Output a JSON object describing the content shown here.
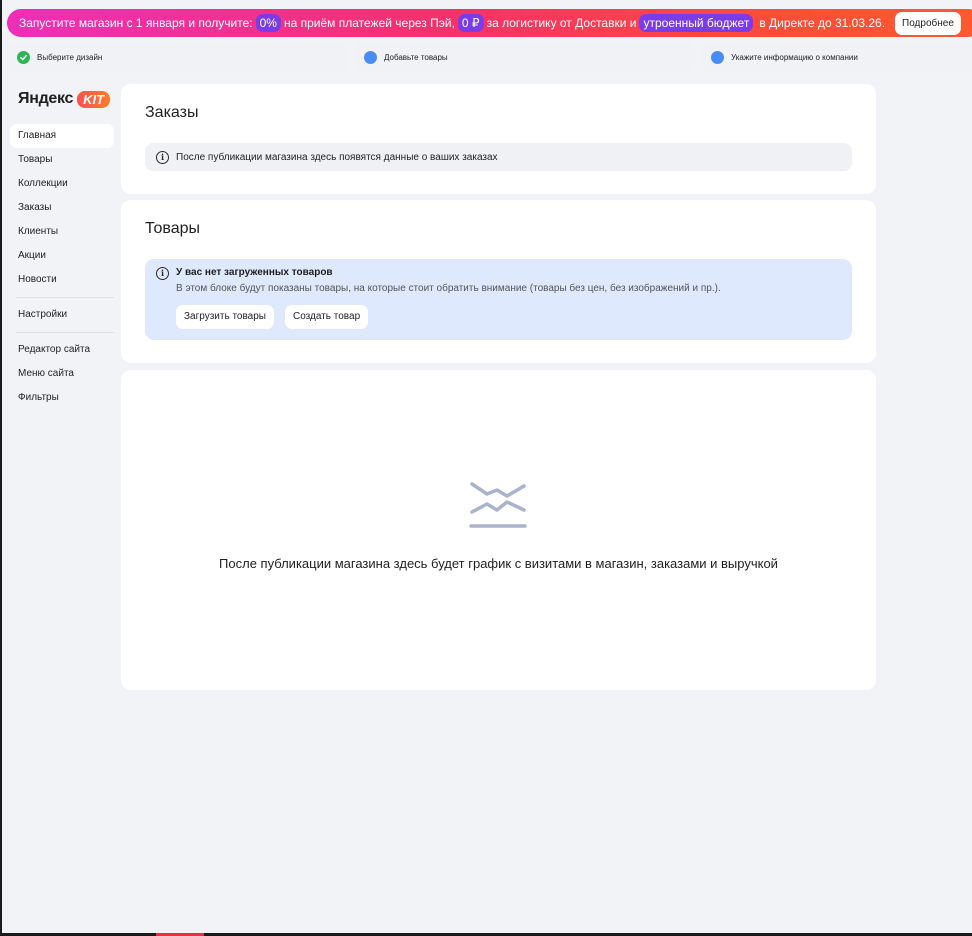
{
  "promo": {
    "text_1": "Запустите магазин с 1 января и получите:",
    "pill_1": "0%",
    "text_2": "на приём платежей через Пэй,",
    "pill_2": "0 ₽",
    "text_3": "за логистику от Доставки и",
    "pill_3": "утроенный бюджет",
    "text_4": "в Директе до 31.03.26.",
    "more_label": "Подробнее"
  },
  "steps": [
    {
      "label": "Выберите дизайн",
      "status": "done"
    },
    {
      "label": "Добавьте товары",
      "status": "todo"
    },
    {
      "label": "Укажите информацию о компании",
      "status": "todo"
    }
  ],
  "logo": {
    "word": "Яндекс",
    "badge": "KIT"
  },
  "nav": {
    "items": [
      {
        "label": "Главная",
        "active": true
      },
      {
        "label": "Товары"
      },
      {
        "label": "Коллекции"
      },
      {
        "label": "Заказы"
      },
      {
        "label": "Клиенты"
      },
      {
        "label": "Акции"
      },
      {
        "label": "Новости"
      }
    ],
    "settings": "Настройки",
    "site_items": [
      {
        "label": "Редактор сайта"
      },
      {
        "label": "Меню сайта"
      },
      {
        "label": "Фильтры"
      }
    ]
  },
  "orders": {
    "title": "Заказы",
    "info": "После публикации магазина здесь появятся данные о ваших заказах"
  },
  "products": {
    "title": "Товары",
    "notice_title": "У вас нет загруженных товаров",
    "notice_text": "В этом блоке будут показаны товары, на которые стоит обратить внимание (товары без цен, без изображений и пр.).",
    "upload_label": "Загрузить товары",
    "create_label": "Создать товар"
  },
  "chart": {
    "message": "После публикации магазина здесь будет график с визитами в магазин, заказами и выручкой"
  },
  "colors": {
    "accent_purple": "#7a3be8",
    "done_green": "#2fb458",
    "todo_blue": "#4a8cf5",
    "notice_bg": "#dfe9fd"
  },
  "icons": {
    "info": "info-icon",
    "check": "check-icon",
    "chart_placeholder": "chart-placeholder-icon"
  }
}
